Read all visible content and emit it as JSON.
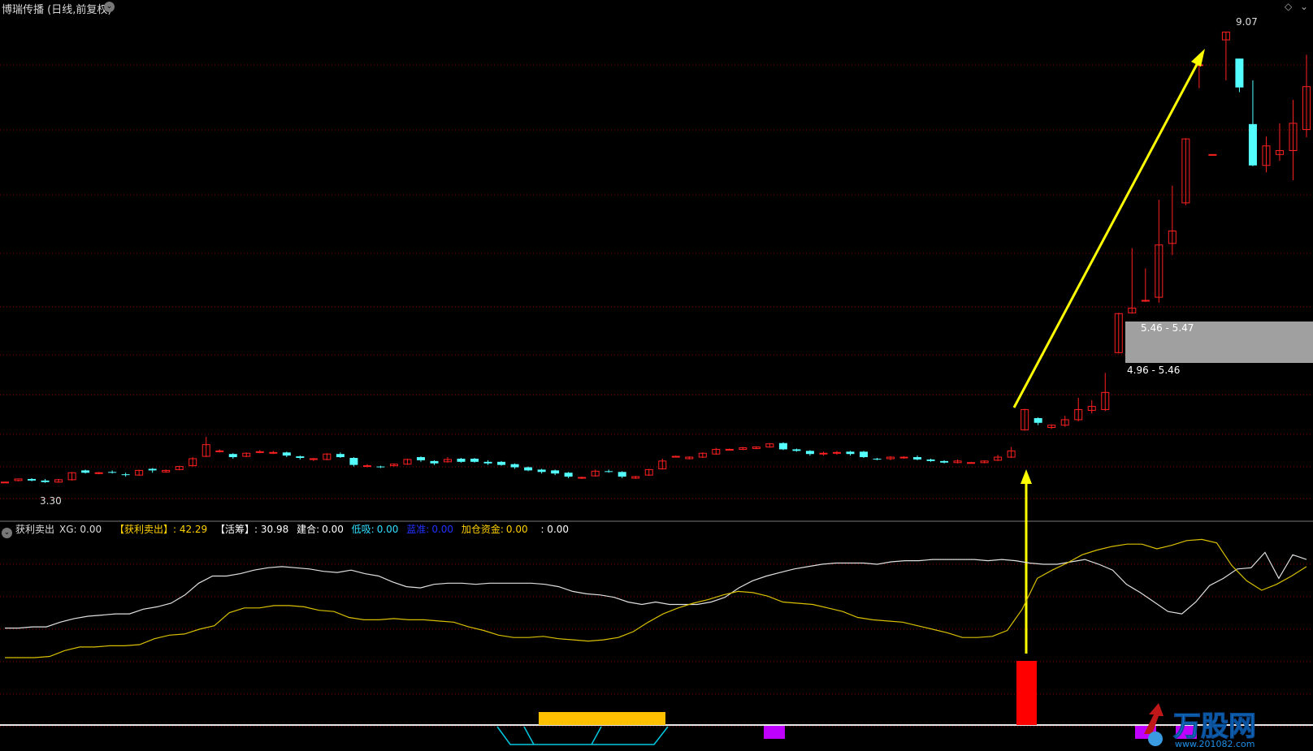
{
  "header": {
    "title": "博瑞传播 (日线,前复权)"
  },
  "price_chart": {
    "high_label": "9.07",
    "low_label": "3.30",
    "range_upper": "5.46 - 5.47",
    "range_lower": "4.96 - 5.46",
    "colors": {
      "up": "#ff2020",
      "down": "#54ffff",
      "arrow": "#ffff00",
      "grid": "#8b0000"
    },
    "candles": [
      [
        3.3,
        3.3,
        3.3,
        3.3
      ],
      [
        3.32,
        3.34,
        3.31,
        3.33
      ],
      [
        3.34,
        3.32,
        3.31,
        3.35
      ],
      [
        3.32,
        3.3,
        3.29,
        3.34
      ],
      [
        3.3,
        3.33,
        3.29,
        3.34
      ],
      [
        3.33,
        3.42,
        3.32,
        3.43
      ],
      [
        3.45,
        3.42,
        3.41,
        3.46
      ],
      [
        3.41,
        3.42,
        3.4,
        3.43
      ],
      [
        3.43,
        3.42,
        3.41,
        3.45
      ],
      [
        3.4,
        3.39,
        3.37,
        3.42
      ],
      [
        3.39,
        3.45,
        3.38,
        3.46
      ],
      [
        3.47,
        3.45,
        3.42,
        3.48
      ],
      [
        3.43,
        3.45,
        3.42,
        3.46
      ],
      [
        3.46,
        3.5,
        3.45,
        3.51
      ],
      [
        3.51,
        3.6,
        3.5,
        3.62
      ],
      [
        3.63,
        3.78,
        3.62,
        3.88
      ],
      [
        3.7,
        3.7,
        3.68,
        3.72
      ],
      [
        3.66,
        3.62,
        3.6,
        3.67
      ],
      [
        3.63,
        3.67,
        3.62,
        3.68
      ],
      [
        3.69,
        3.69,
        3.67,
        3.71
      ],
      [
        3.68,
        3.68,
        3.66,
        3.7
      ],
      [
        3.68,
        3.64,
        3.62,
        3.69
      ],
      [
        3.63,
        3.61,
        3.59,
        3.64
      ],
      [
        3.6,
        3.6,
        3.57,
        3.61
      ],
      [
        3.59,
        3.66,
        3.58,
        3.67
      ],
      [
        3.66,
        3.62,
        3.61,
        3.68
      ],
      [
        3.61,
        3.52,
        3.5,
        3.62
      ],
      [
        3.51,
        3.51,
        3.49,
        3.53
      ],
      [
        3.5,
        3.49,
        3.48,
        3.51
      ],
      [
        3.51,
        3.53,
        3.5,
        3.54
      ],
      [
        3.53,
        3.59,
        3.52,
        3.6
      ],
      [
        3.62,
        3.58,
        3.56,
        3.63
      ],
      [
        3.57,
        3.54,
        3.52,
        3.58
      ],
      [
        3.56,
        3.59,
        3.55,
        3.62
      ],
      [
        3.6,
        3.56,
        3.55,
        3.61
      ],
      [
        3.6,
        3.56,
        3.55,
        3.61
      ],
      [
        3.56,
        3.54,
        3.52,
        3.58
      ],
      [
        3.56,
        3.52,
        3.51,
        3.57
      ],
      [
        3.53,
        3.49,
        3.47,
        3.54
      ],
      [
        3.49,
        3.45,
        3.44,
        3.5
      ],
      [
        3.46,
        3.43,
        3.41,
        3.47
      ],
      [
        3.45,
        3.41,
        3.39,
        3.46
      ],
      [
        3.42,
        3.37,
        3.35,
        3.43
      ],
      [
        3.36,
        3.36,
        3.34,
        3.37
      ],
      [
        3.38,
        3.44,
        3.37,
        3.46
      ],
      [
        3.44,
        3.43,
        3.42,
        3.46
      ],
      [
        3.43,
        3.37,
        3.35,
        3.44
      ],
      [
        3.35,
        3.37,
        3.34,
        3.38
      ],
      [
        3.39,
        3.46,
        3.38,
        3.47
      ],
      [
        3.47,
        3.57,
        3.46,
        3.6
      ],
      [
        3.63,
        3.63,
        3.62,
        3.64
      ],
      [
        3.6,
        3.62,
        3.59,
        3.63
      ],
      [
        3.62,
        3.67,
        3.61,
        3.68
      ],
      [
        3.66,
        3.72,
        3.65,
        3.74
      ],
      [
        3.72,
        3.72,
        3.71,
        3.73
      ],
      [
        3.72,
        3.74,
        3.71,
        3.75
      ],
      [
        3.73,
        3.75,
        3.72,
        3.76
      ],
      [
        3.75,
        3.79,
        3.74,
        3.8
      ],
      [
        3.8,
        3.72,
        3.71,
        3.81
      ],
      [
        3.72,
        3.7,
        3.69,
        3.73
      ],
      [
        3.7,
        3.66,
        3.64,
        3.71
      ],
      [
        3.66,
        3.67,
        3.64,
        3.69
      ],
      [
        3.68,
        3.68,
        3.65,
        3.7
      ],
      [
        3.69,
        3.66,
        3.64,
        3.7
      ],
      [
        3.69,
        3.62,
        3.61,
        3.7
      ],
      [
        3.6,
        3.59,
        3.58,
        3.61
      ],
      [
        3.6,
        3.62,
        3.58,
        3.63
      ],
      [
        3.62,
        3.62,
        3.6,
        3.63
      ],
      [
        3.62,
        3.59,
        3.58,
        3.64
      ],
      [
        3.59,
        3.57,
        3.56,
        3.6
      ],
      [
        3.57,
        3.55,
        3.54,
        3.58
      ],
      [
        3.55,
        3.57,
        3.54,
        3.59
      ],
      [
        3.55,
        3.55,
        3.54,
        3.56
      ],
      [
        3.55,
        3.57,
        3.54,
        3.58
      ],
      [
        3.58,
        3.62,
        3.57,
        3.65
      ],
      [
        3.62,
        3.7,
        3.61,
        3.75
      ],
      [
        3.97,
        4.23,
        3.96,
        4.24
      ],
      [
        4.12,
        4.06,
        4.03,
        4.13
      ],
      [
        4.0,
        4.03,
        3.98,
        4.04
      ],
      [
        4.03,
        4.1,
        4.01,
        4.15
      ],
      [
        4.1,
        4.23,
        4.08,
        4.38
      ],
      [
        4.22,
        4.27,
        4.18,
        4.35
      ],
      [
        4.23,
        4.45,
        4.21,
        4.7
      ],
      [
        4.96,
        5.46,
        4.95,
        5.47
      ],
      [
        5.47,
        5.53,
        5.46,
        6.3
      ],
      [
        5.63,
        5.63,
        5.61,
        6.04
      ],
      [
        5.67,
        6.34,
        5.6,
        6.92
      ],
      [
        6.36,
        6.52,
        6.21,
        7.1
      ],
      [
        6.88,
        7.7,
        6.85,
        7.71
      ],
      [
        8.65,
        8.65,
        8.35,
        8.65
      ],
      [
        7.5,
        7.5,
        7.5,
        7.5
      ],
      [
        8.97,
        9.07,
        8.45,
        9.07
      ],
      [
        8.73,
        8.36,
        8.3,
        8.73
      ],
      [
        7.89,
        7.36,
        7.35,
        8.45
      ],
      [
        7.36,
        7.61,
        7.27,
        7.73
      ],
      [
        7.5,
        7.55,
        7.42,
        7.9
      ],
      [
        7.55,
        7.9,
        7.17,
        8.2
      ],
      [
        7.82,
        8.37,
        7.72,
        8.78
      ]
    ]
  },
  "indicator": {
    "name": "获利卖出",
    "xg": "XG: 0.00",
    "profit_label": "【获利卖出】",
    "profit_value": ": 42.29",
    "active_label": "【活筹】",
    "active_value": ": 30.98",
    "build_label": "建合:",
    "build_value": "0.00",
    "low_label": "低吸:",
    "low_value": "0.00",
    "blue_label": "蓝准:",
    "blue_value": "0.00",
    "add_label": "加仓资金:",
    "add_value": "0.00",
    "blank_value": ": 0.00",
    "colors": {
      "white_line": "#e0e0e0",
      "yellow_line": "#d8c000",
      "red_bar": "#ff0000",
      "gold_bar": "#ffc000",
      "purple": "#c000ff",
      "cyan": "#00c8e0"
    },
    "white_line": [
      82,
      82,
      83,
      83,
      87,
      90,
      92,
      93,
      94,
      94,
      98,
      100,
      103,
      110,
      120,
      126,
      126,
      128,
      131,
      133,
      134,
      133,
      132,
      130,
      129,
      131,
      128,
      126,
      121,
      117,
      116,
      119,
      120,
      120,
      119,
      120,
      120,
      120,
      120,
      119,
      117,
      113,
      111,
      110,
      108,
      104,
      102,
      104,
      102,
      102,
      102,
      104,
      108,
      116,
      122,
      126,
      129,
      132,
      134,
      136,
      137,
      137,
      137,
      136,
      138,
      139,
      139,
      140,
      140,
      140,
      140,
      139,
      140,
      139,
      137,
      136,
      136,
      138,
      140,
      136,
      131,
      119,
      112,
      104,
      96,
      94,
      104,
      118,
      124,
      132,
      133,
      146,
      124,
      144,
      140
    ],
    "yellow_line": [
      57,
      57,
      57,
      58,
      63,
      66,
      66,
      67,
      67,
      68,
      73,
      76,
      77,
      81,
      84,
      95,
      99,
      99,
      101,
      101,
      100,
      97,
      96,
      91,
      89,
      89,
      90,
      89,
      89,
      88,
      87,
      83,
      80,
      76,
      74,
      74,
      75,
      73,
      72,
      71,
      72,
      74,
      79,
      87,
      94,
      99,
      103,
      106,
      110,
      113,
      112,
      109,
      104,
      103,
      102,
      99,
      96,
      91,
      89,
      88,
      87,
      84,
      81,
      78,
      74,
      74,
      75,
      80,
      98,
      124,
      131,
      137,
      144,
      148,
      151,
      153,
      153,
      149,
      152,
      156,
      157,
      154,
      135,
      122,
      114,
      119,
      126,
      134
    ]
  },
  "watermark": {
    "brand": "万股网",
    "site": "www.201082.com"
  }
}
